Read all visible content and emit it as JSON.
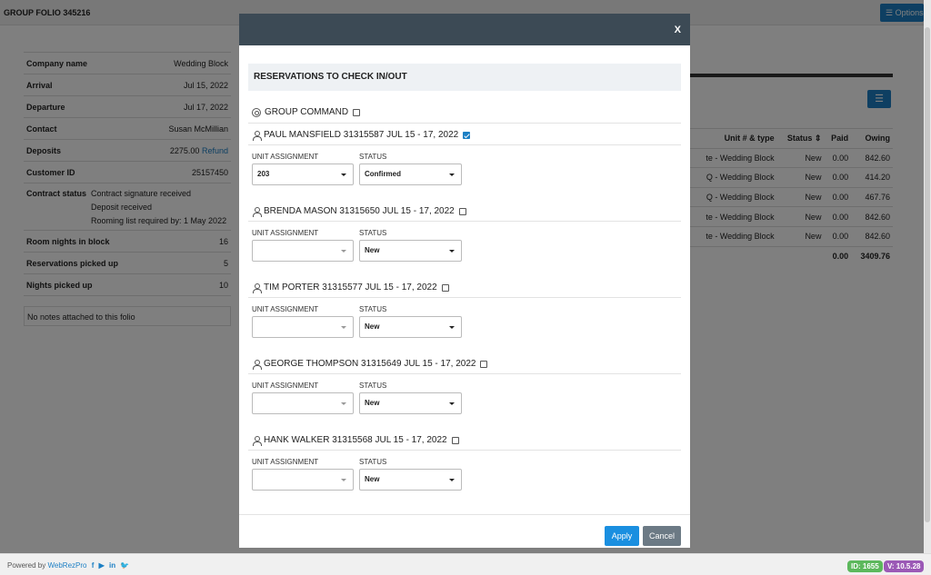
{
  "header": {
    "folio_title": "GROUP FOLIO 345216",
    "options_label": "Options"
  },
  "info": {
    "company_name_label": "Company name",
    "company_name": "Wedding Block",
    "arrival_label": "Arrival",
    "arrival": "Jul 15, 2022",
    "departure_label": "Departure",
    "departure": "Jul 17, 2022",
    "contact_label": "Contact",
    "contact": "Susan McMillian",
    "deposits_label": "Deposits",
    "deposits": "2275.00",
    "refund_link": "Refund",
    "customer_id_label": "Customer ID",
    "customer_id": "25157450",
    "contract_status_label": "Contract status",
    "contract_lines": [
      "Contract signature received",
      "Deposit received",
      "Rooming list required by: 1 May 2022"
    ],
    "room_nights_label": "Room nights in block",
    "room_nights": "16",
    "reservations_picked_label": "Reservations picked up",
    "reservations_picked": "5",
    "nights_picked_label": "Nights picked up",
    "nights_picked": "10",
    "notes": "No notes attached to this folio"
  },
  "bg_table": {
    "headers": {
      "unit": "Unit # & type",
      "status": "Status",
      "paid": "Paid",
      "owing": "Owing"
    },
    "rows": [
      {
        "unit": "te - Wedding Block",
        "status": "New",
        "paid": "0.00",
        "owing": "842.60"
      },
      {
        "unit": "Q - Wedding Block",
        "status": "New",
        "paid": "0.00",
        "owing": "414.20"
      },
      {
        "unit": "Q - Wedding Block",
        "status": "New",
        "paid": "0.00",
        "owing": "467.76"
      },
      {
        "unit": "te - Wedding Block",
        "status": "New",
        "paid": "0.00",
        "owing": "842.60"
      },
      {
        "unit": "te - Wedding Block",
        "status": "New",
        "paid": "0.00",
        "owing": "842.60"
      }
    ],
    "total_paid": "0.00",
    "total_owing": "3409.76"
  },
  "modal": {
    "close_label": "X",
    "section_title": "RESERVATIONS TO CHECK IN/OUT",
    "group_command_label": "GROUP COMMAND",
    "unit_label": "UNIT ASSIGNMENT",
    "status_label": "STATUS",
    "reservations": [
      {
        "guest": "PAUL MANSFIELD 31315587 JUL 15 - 17, 2022",
        "checked": true,
        "unit": "203",
        "status": "Confirmed"
      },
      {
        "guest": "BRENDA MASON 31315650 JUL 15 - 17, 2022",
        "checked": false,
        "unit": "",
        "status": "New"
      },
      {
        "guest": "TIM PORTER 31315577 JUL 15 - 17, 2022",
        "checked": false,
        "unit": "",
        "status": "New"
      },
      {
        "guest": "GEORGE THOMPSON 31315649 JUL 15 - 17, 2022",
        "checked": false,
        "unit": "",
        "status": "New"
      },
      {
        "guest": "HANK WALKER 31315568 JUL 15 - 17, 2022",
        "checked": false,
        "unit": "",
        "status": "New"
      }
    ],
    "apply_label": "Apply",
    "cancel_label": "Cancel"
  },
  "footer": {
    "powered_prefix": "Powered by",
    "powered_brand": "WebRezPro",
    "id_badge": "ID: 1655",
    "version_badge": "V: 10.5.28"
  },
  "colors": {
    "primary": "#1c7fc4",
    "modal_header": "#3c4a55",
    "id_badge": "#5cb85c",
    "version_badge": "#9b59b6"
  }
}
